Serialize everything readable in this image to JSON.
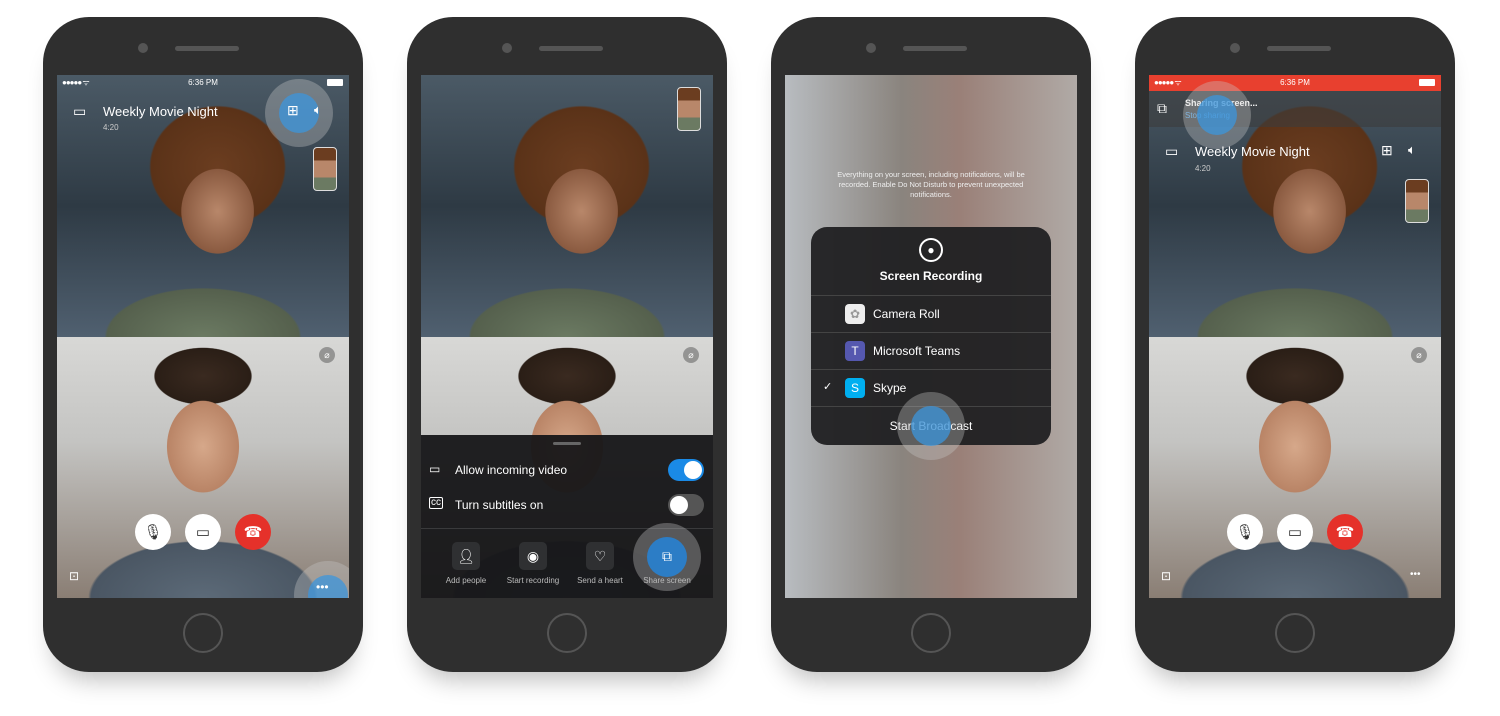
{
  "status_bar": {
    "time": "6:36 PM",
    "signal": "●●●●● ᯤ"
  },
  "call": {
    "title": "Weekly Movie Night",
    "duration": "4:20"
  },
  "sheet": {
    "options": [
      {
        "label": "Allow incoming video",
        "on": true
      },
      {
        "label": "Turn subtitles on",
        "on": false
      }
    ],
    "actions": [
      {
        "label": "Add people",
        "icon": "add-person-icon"
      },
      {
        "label": "Start recording",
        "icon": "record-icon"
      },
      {
        "label": "Send a heart",
        "icon": "heart-icon"
      },
      {
        "label": "Share screen",
        "icon": "share-screen-icon"
      }
    ]
  },
  "recording": {
    "notice": "Everything on your screen, including notifications, will be recorded. Enable Do Not Disturb to prevent unexpected notifications.",
    "title": "Screen Recording",
    "targets": [
      {
        "label": "Camera Roll",
        "checked": false
      },
      {
        "label": "Microsoft Teams",
        "checked": false
      },
      {
        "label": "Skype",
        "checked": true
      }
    ],
    "start_label": "Start Broadcast",
    "check": "✓"
  },
  "sharing": {
    "title": "Sharing screen...",
    "stop_label": "Stop sharing"
  },
  "colors": {
    "accent": "#0078d4",
    "end_call": "#e5312a",
    "sharing_bar": "#e8402f",
    "toggle_on": "#1a8ae6"
  }
}
